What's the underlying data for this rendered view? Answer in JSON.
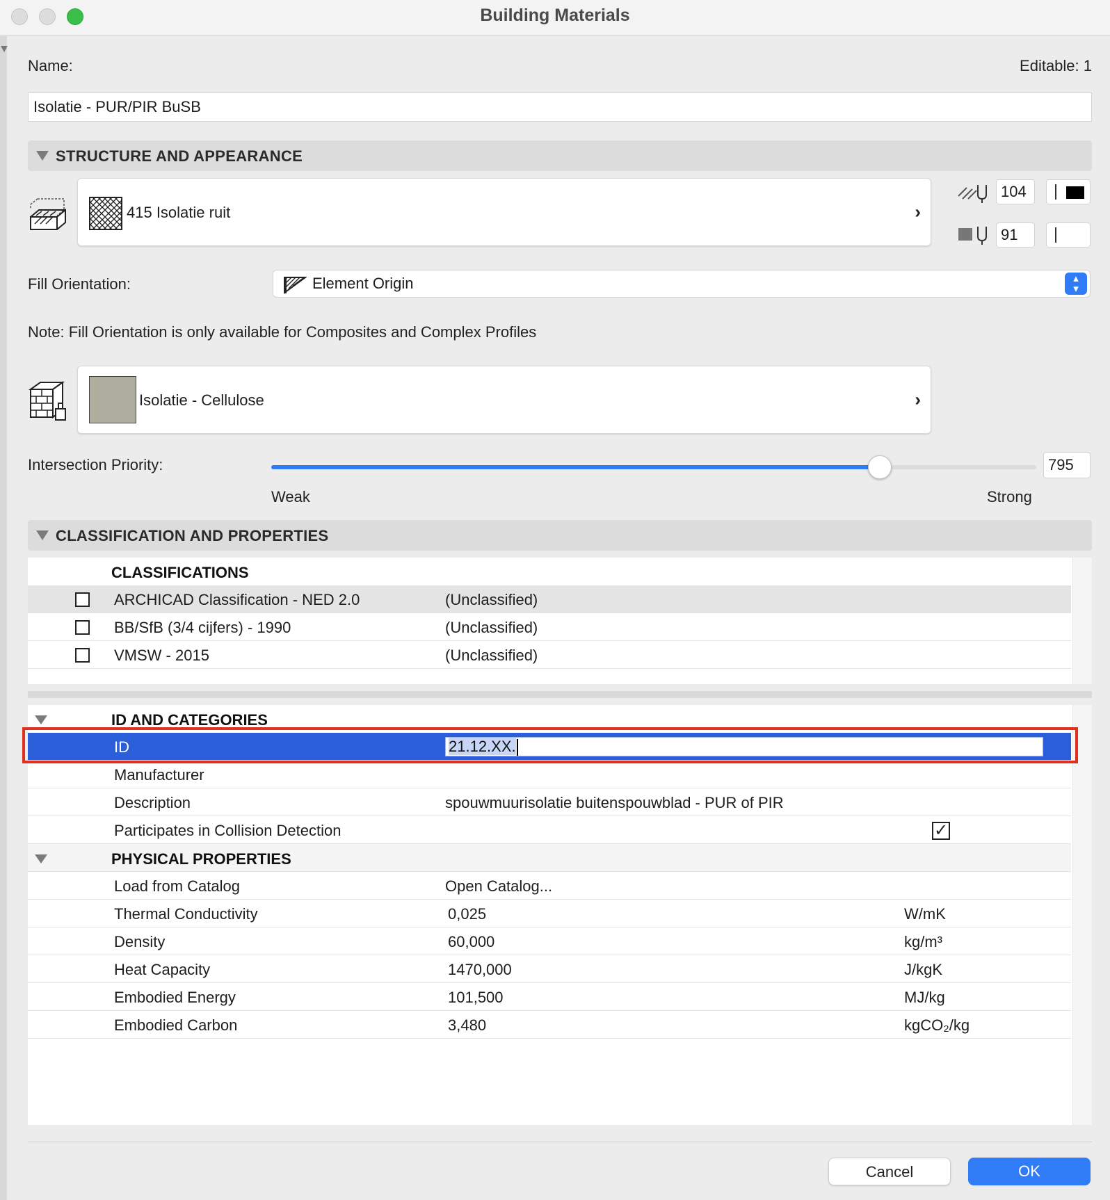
{
  "window": {
    "title": "Building Materials"
  },
  "name_label": "Name:",
  "editable_label": "Editable: 1",
  "name_value": "Isolatie - PUR/PIR BuSB",
  "sections": {
    "structure": "STRUCTURE AND APPEARANCE",
    "classification": "CLASSIFICATION AND PROPERTIES"
  },
  "cut_fill": {
    "label": "415 Isolatie ruit",
    "icon": "hatch-pattern-icon"
  },
  "pens": {
    "foreground": "104",
    "background": "91",
    "foreground_color": "#000000",
    "background_color": "#ffffff"
  },
  "fill_orientation": {
    "label": "Fill Orientation:",
    "value": "Element Origin"
  },
  "note": "Note: Fill Orientation is only available for Composites and Complex Profiles",
  "surface": {
    "label": "Isolatie - Cellulose",
    "swatch_color": "#aeae9e"
  },
  "intersection": {
    "label": "Intersection Priority:",
    "value": "795",
    "min_label": "Weak",
    "max_label": "Strong",
    "level_fraction": 0.795
  },
  "classifications": {
    "header": "CLASSIFICATIONS",
    "rows": [
      {
        "name": "ARCHICAD Classification - NED 2.0",
        "value": "(Unclassified)"
      },
      {
        "name": "BB/SfB (3/4 cijfers) - 1990",
        "value": "(Unclassified)"
      },
      {
        "name": "VMSW - 2015",
        "value": "(Unclassified)"
      }
    ]
  },
  "id_categories": {
    "header": "ID AND CATEGORIES",
    "id_label": "ID",
    "id_value": "21.12.XX.",
    "manufacturer_label": "Manufacturer",
    "description_label": "Description",
    "description_value": "spouwmuurisolatie buitenspouwblad - PUR of PIR",
    "collision_label": "Participates in Collision Detection"
  },
  "physical": {
    "header": "PHYSICAL PROPERTIES",
    "catalog_label": "Load from Catalog",
    "catalog_value": "Open Catalog...",
    "rows": [
      {
        "name": "Thermal Conductivity",
        "value": "0,025",
        "unit": "W/mK"
      },
      {
        "name": "Density",
        "value": "60,000",
        "unit": "kg/m³"
      },
      {
        "name": "Heat Capacity",
        "value": "1470,000",
        "unit": "J/kgK"
      },
      {
        "name": "Embodied Energy",
        "value": "101,500",
        "unit": "MJ/kg"
      },
      {
        "name": "Embodied Carbon",
        "value": "3,480",
        "unit": "kgCO₂/kg"
      }
    ]
  },
  "buttons": {
    "cancel": "Cancel",
    "ok": "OK"
  },
  "colors": {
    "accent": "#2f7cf6",
    "selection": "#2b5fd9",
    "highlight_border": "#e0301e"
  }
}
